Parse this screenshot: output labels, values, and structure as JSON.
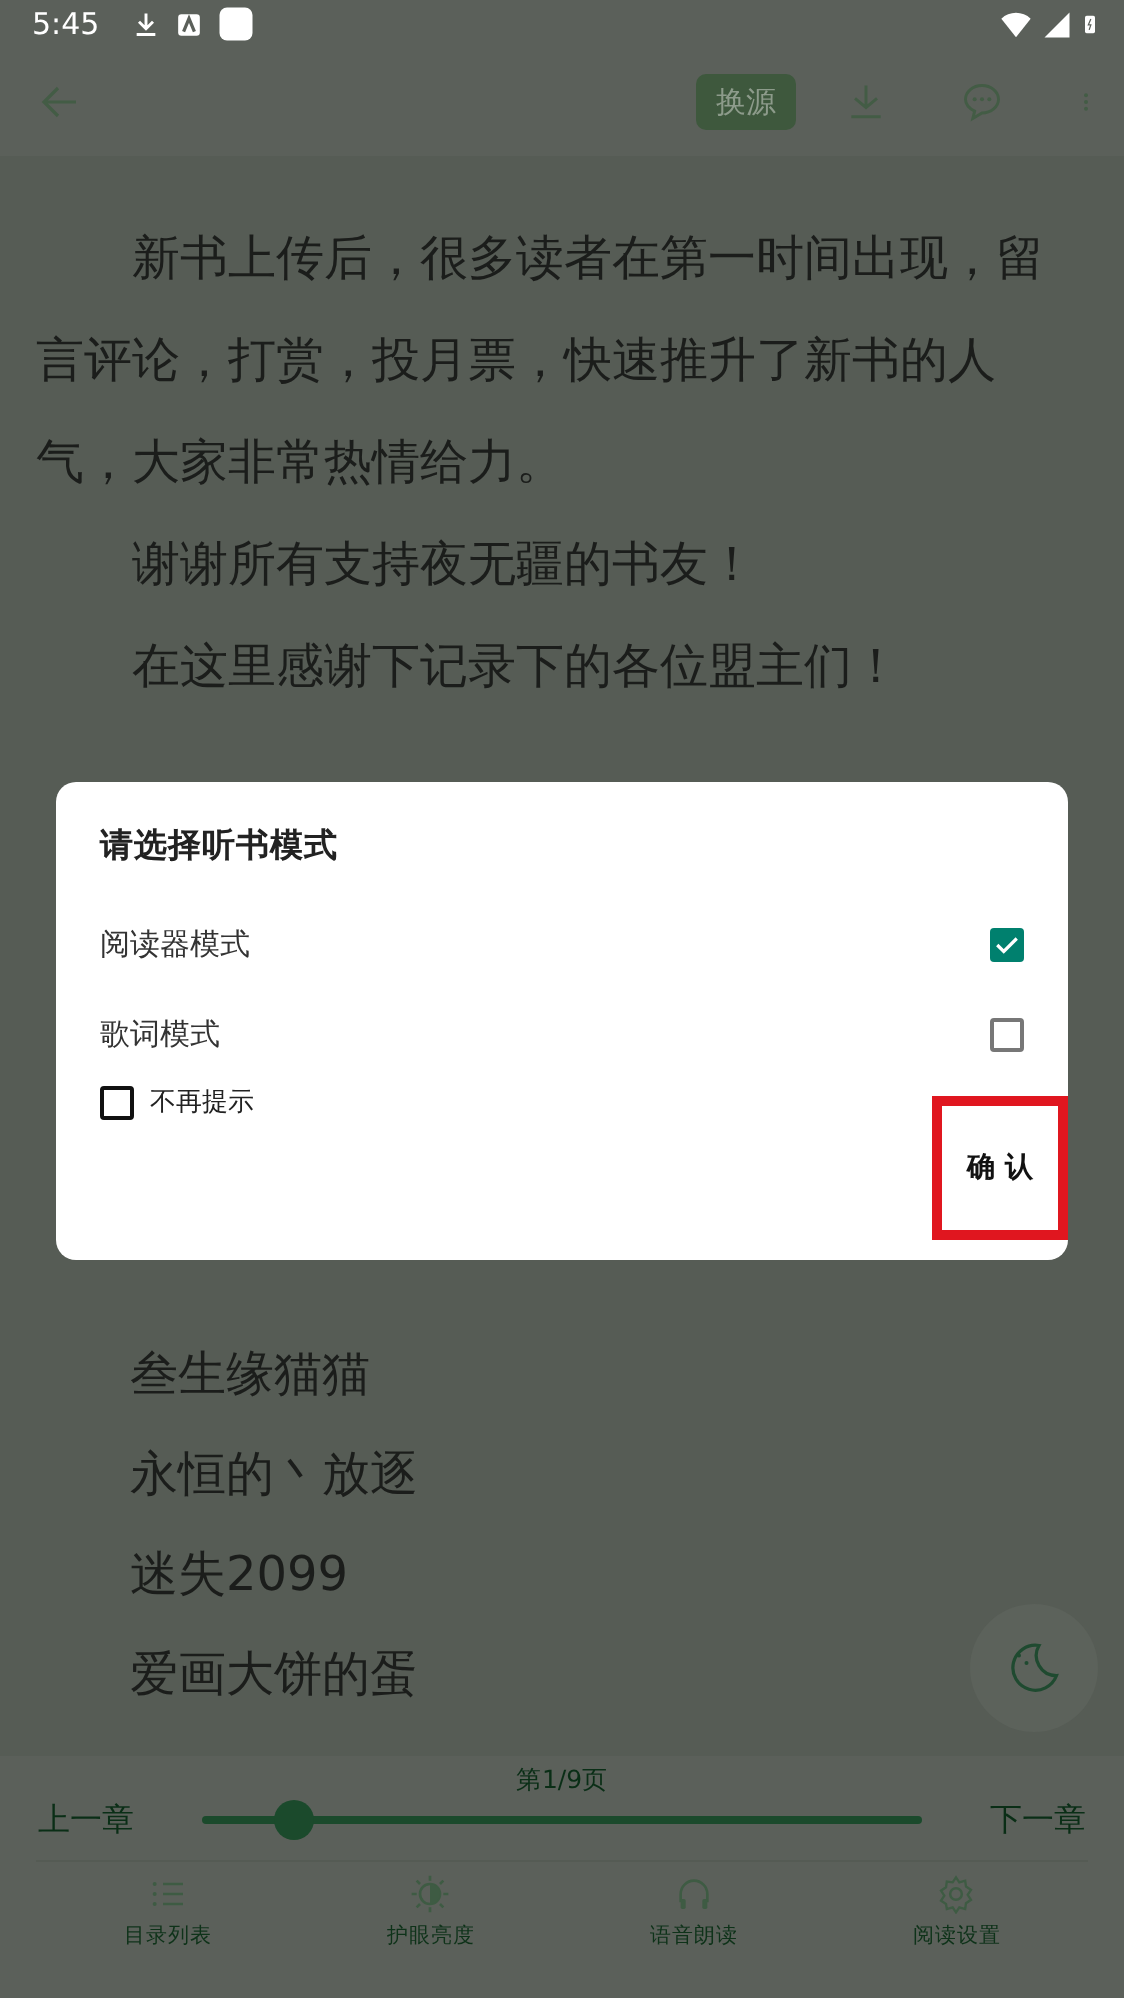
{
  "status_bar": {
    "time": "5:45"
  },
  "toolbar": {
    "source_button": "换源"
  },
  "chapter": {
    "paragraphs": [
      "新书上传后，很多读者在第一时间出现，留言评论，打赏，投月票，快速推升了新书的人气，大家非常热情给力。",
      "谢谢所有支持夜无疆的书友！",
      "在这里感谢下记录下的各位盟主们！"
    ],
    "names": [
      "叁生缘猫猫",
      "永恒的丶放逐",
      "迷失2099",
      "爱画大饼的蛋"
    ]
  },
  "dialog": {
    "title": "请选择听书模式",
    "options": [
      {
        "label": "阅读器模式",
        "checked": true
      },
      {
        "label": "歌词模式",
        "checked": false
      }
    ],
    "dont_remind": {
      "label": "不再提示",
      "checked": false
    },
    "confirm_button": "确 认",
    "highlighted": true
  },
  "bottom_bar": {
    "page": "第1/9页",
    "prev": "上一章",
    "next": "下一章",
    "level": 0.105,
    "tabs": [
      {
        "kind": "list",
        "label": "目录列表"
      },
      {
        "kind": "brightness",
        "label": "护眼亮度"
      },
      {
        "kind": "headphones",
        "label": "语音朗读"
      },
      {
        "kind": "gear",
        "label": "阅读设置"
      }
    ]
  }
}
